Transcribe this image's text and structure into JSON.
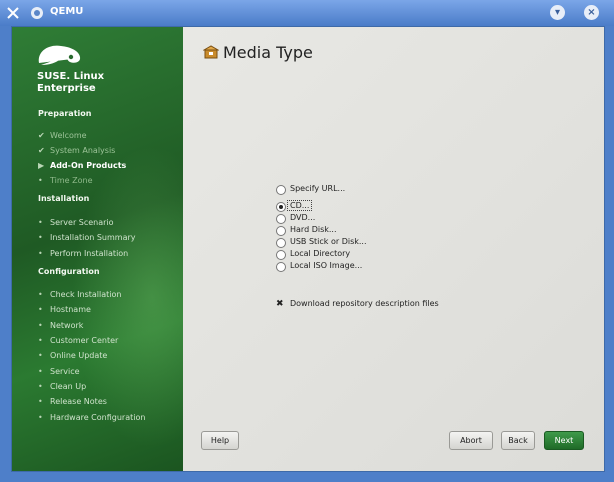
{
  "window": {
    "title": "QEMU"
  },
  "brand": {
    "line1": "SUSE. Linux",
    "line2": "Enterprise"
  },
  "sidebar": {
    "sections": [
      {
        "title": "Preparation",
        "steps": [
          {
            "label": "Welcome",
            "state": "done"
          },
          {
            "label": "System Analysis",
            "state": "done"
          },
          {
            "label": "Add-On Products",
            "state": "current"
          },
          {
            "label": "Time Zone",
            "state": "future"
          }
        ]
      },
      {
        "title": "Installation",
        "steps": [
          {
            "label": "Server Scenario",
            "state": "todo"
          },
          {
            "label": "Installation Summary",
            "state": "todo"
          },
          {
            "label": "Perform Installation",
            "state": "todo"
          }
        ]
      },
      {
        "title": "Configuration",
        "steps": [
          {
            "label": "Check Installation",
            "state": "todo"
          },
          {
            "label": "Hostname",
            "state": "todo"
          },
          {
            "label": "Network",
            "state": "todo"
          },
          {
            "label": "Customer Center",
            "state": "todo"
          },
          {
            "label": "Online Update",
            "state": "todo"
          },
          {
            "label": "Service",
            "state": "todo"
          },
          {
            "label": "Clean Up",
            "state": "todo"
          },
          {
            "label": "Release Notes",
            "state": "todo"
          },
          {
            "label": "Hardware Configuration",
            "state": "todo"
          }
        ]
      }
    ]
  },
  "main": {
    "title": "Media Type",
    "options": [
      {
        "label": "Specify URL...",
        "selected": false
      },
      {
        "label": "CD...",
        "selected": true
      },
      {
        "label": "DVD...",
        "selected": false
      },
      {
        "label": "Hard Disk...",
        "selected": false
      },
      {
        "label": "USB Stick or Disk...",
        "selected": false
      },
      {
        "label": "Local Directory",
        "selected": false
      },
      {
        "label": "Local ISO Image...",
        "selected": false
      }
    ],
    "checkbox": {
      "label": "Download repository description files",
      "checked": true
    }
  },
  "buttons": {
    "help": "Help",
    "abort": "Abort",
    "back": "Back",
    "next": "Next"
  },
  "colors": {
    "accent_green": "#2f7d36",
    "title_blue": "#4a7cc8"
  }
}
